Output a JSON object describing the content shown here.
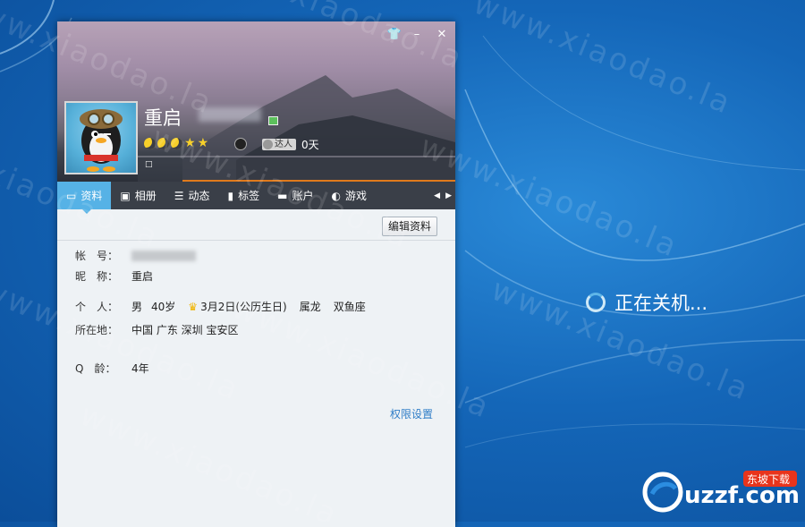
{
  "window": {
    "controls": {
      "skin": "skin-icon",
      "minimize": "–",
      "close": "✕"
    },
    "profile": {
      "nickname": "重启",
      "days_label": "达人",
      "days_value": "0天",
      "signature": "□"
    },
    "tabs": [
      {
        "label": "资料",
        "icon": "profile-card-icon",
        "glyph": "▭"
      },
      {
        "label": "相册",
        "icon": "photo-album-icon",
        "glyph": "▣"
      },
      {
        "label": "动态",
        "icon": "feed-list-icon",
        "glyph": "☰"
      },
      {
        "label": "标签",
        "icon": "bookmark-icon",
        "glyph": "▮"
      },
      {
        "label": "账户",
        "icon": "wallet-icon",
        "glyph": "▬"
      },
      {
        "label": "游戏",
        "icon": "game-icon",
        "glyph": "◐"
      }
    ],
    "edit_button": "编辑资料",
    "fields": {
      "account_label": "帐　号：",
      "nickname_label": "昵　称：",
      "nickname_value": "重启",
      "personal_label": "个　人：",
      "gender": "男",
      "age": "40岁",
      "birthday": "3月2日(公历生日)",
      "zodiac": "属龙",
      "constellation": "双鱼座",
      "location_label": "所在地：",
      "location_value": "中国 广东 深圳 宝安区",
      "qage_label": "Q　龄：",
      "qage_value": "4年"
    },
    "permission_link": "权限设置"
  },
  "desktop": {
    "shutdown_text": "正在关机...",
    "watermark": "www.xiaodao.la"
  },
  "logo": {
    "brand": "uzzf.com",
    "badge": "东坡下载"
  },
  "colors": {
    "accent": "#56b2e6",
    "orange": "#e07a1c",
    "link": "#2f7dc7"
  }
}
